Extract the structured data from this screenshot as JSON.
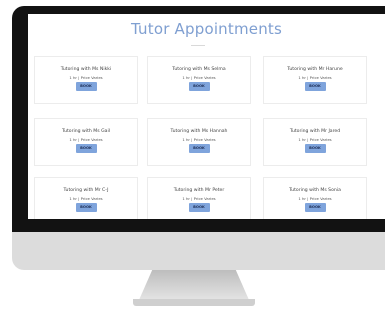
{
  "page": {
    "title": "Tutor Appointments"
  },
  "colors": {
    "accent": "#7f9fd1",
    "button": "#7fa4dc",
    "bezel": "#121212",
    "chin": "#dcdcdc"
  },
  "cards": [
    {
      "title": "Tutoring with Ms Nikki",
      "meta": "1 hr  |  Price Varies",
      "button": "BOOK"
    },
    {
      "title": "Tutoring with Ms Selma",
      "meta": "1 hr  |  Price Varies",
      "button": "BOOK"
    },
    {
      "title": "Tutoring with Mr Harune",
      "meta": "1 hr  |  Price Varies",
      "button": "BOOK"
    },
    {
      "title": "Tutoring with Ms Gail",
      "meta": "1 hr  |  Price Varies",
      "button": "BOOK"
    },
    {
      "title": "Tutoring with Ms Hannah",
      "meta": "1 hr  |  Price Varies",
      "button": "BOOK"
    },
    {
      "title": "Tutoring with Mr Jared",
      "meta": "1 hr  |  Price Varies",
      "button": "BOOK"
    },
    {
      "title": "Tutoring with Mr C-J",
      "meta": "1 hr  |  Price Varies",
      "button": "BOOK"
    },
    {
      "title": "Tutoring with Mr Peter",
      "meta": "1 hr  |  Price Varies",
      "button": "BOOK"
    },
    {
      "title": "Tutoring with Ms Sonia",
      "meta": "1 hr  |  Price Varies",
      "button": "BOOK"
    }
  ]
}
